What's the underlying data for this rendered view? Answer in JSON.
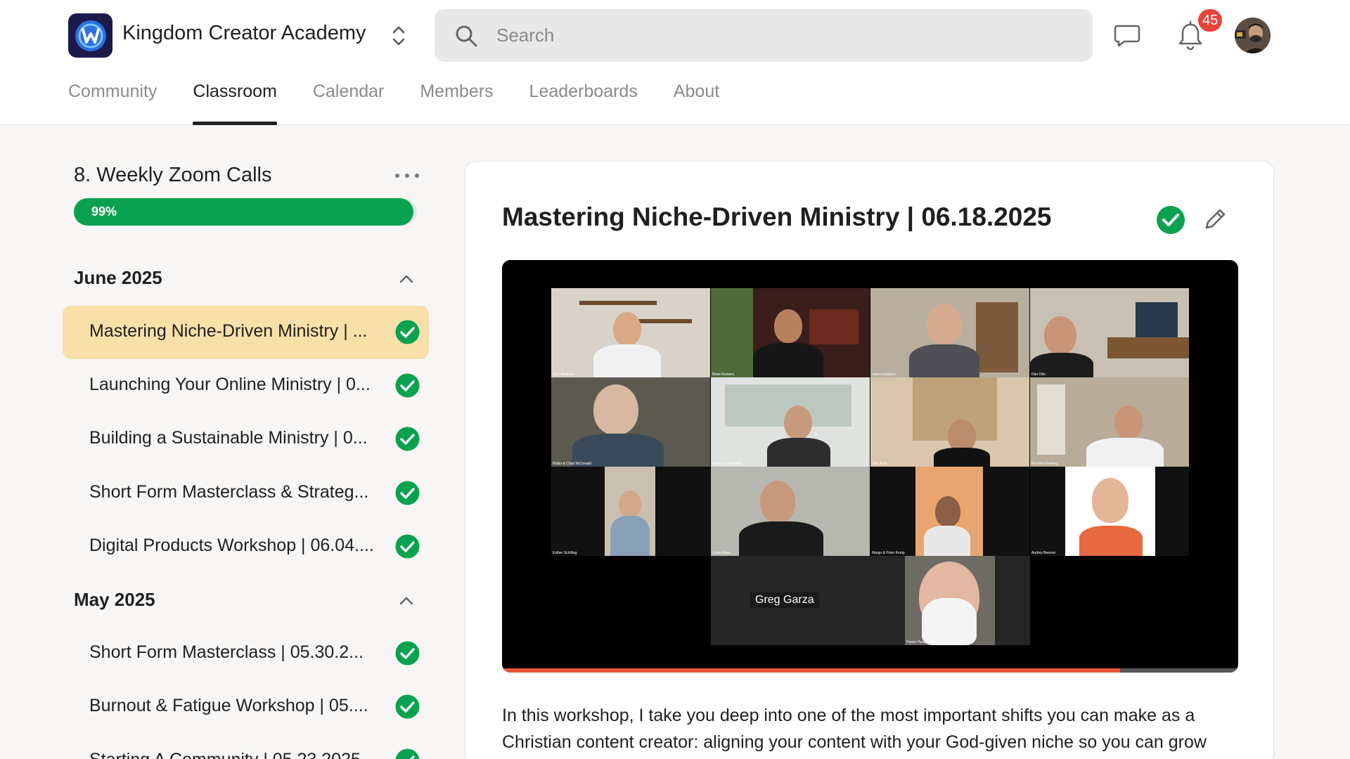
{
  "header": {
    "app_title": "Kingdom Creator Academy",
    "search_placeholder": "Search",
    "notification_count": "45"
  },
  "tabs": [
    {
      "label": "Community"
    },
    {
      "label": "Classroom",
      "active": true
    },
    {
      "label": "Calendar"
    },
    {
      "label": "Members"
    },
    {
      "label": "Leaderboards"
    },
    {
      "label": "About"
    }
  ],
  "course": {
    "title": "8. Weekly Zoom Calls",
    "progress": 99,
    "progress_label": "99%"
  },
  "sections": [
    {
      "title": "June 2025",
      "lessons": [
        {
          "label": "Mastering Niche-Driven Ministry | ...",
          "completed": true,
          "active": true
        },
        {
          "label": "Launching Your Online Ministry | 0...",
          "completed": true
        },
        {
          "label": "Building a Sustainable Ministry | 0...",
          "completed": true
        },
        {
          "label": "Short Form Masterclass & Strateg...",
          "completed": true
        },
        {
          "label": "Digital Products Workshop | 06.04....",
          "completed": true
        }
      ]
    },
    {
      "title": "May 2025",
      "lessons": [
        {
          "label": "Short Form Masterclass | 05.30.2...",
          "completed": true
        },
        {
          "label": "Burnout & Fatigue Workshop | 05....",
          "completed": true
        },
        {
          "label": "Starting A Community | 05.23.2025",
          "completed": true
        }
      ]
    }
  ],
  "lesson": {
    "title": "Mastering Niche-Driven Ministry | 06.18.2025",
    "completed": true,
    "description": "In this workshop, I take you deep into one of the most important shifts you can make as a Christian content creator: aligning your content with your God-given niche so you can grow"
  },
  "video": {
    "speaker_label": "Greg Garza",
    "progress": 0.84,
    "participants": [
      "Julio Alvarado",
      "Brian Romero",
      "Laura Goodrich",
      "Dan Otto",
      "Robin & Chad McDonald",
      "Susana Hernandez",
      "Julie Park",
      "Brandon Keeling",
      "Esther Schilling",
      "Loren Alves",
      "Margo & Peter Kemp",
      "Audrey Benson",
      "Pastor Paul Beard"
    ]
  },
  "colors": {
    "accent_green": "#0aa24f",
    "active_lesson_bg": "#f9e0a9",
    "badge_red": "#e7443a",
    "video_progress": "#e8543b"
  }
}
